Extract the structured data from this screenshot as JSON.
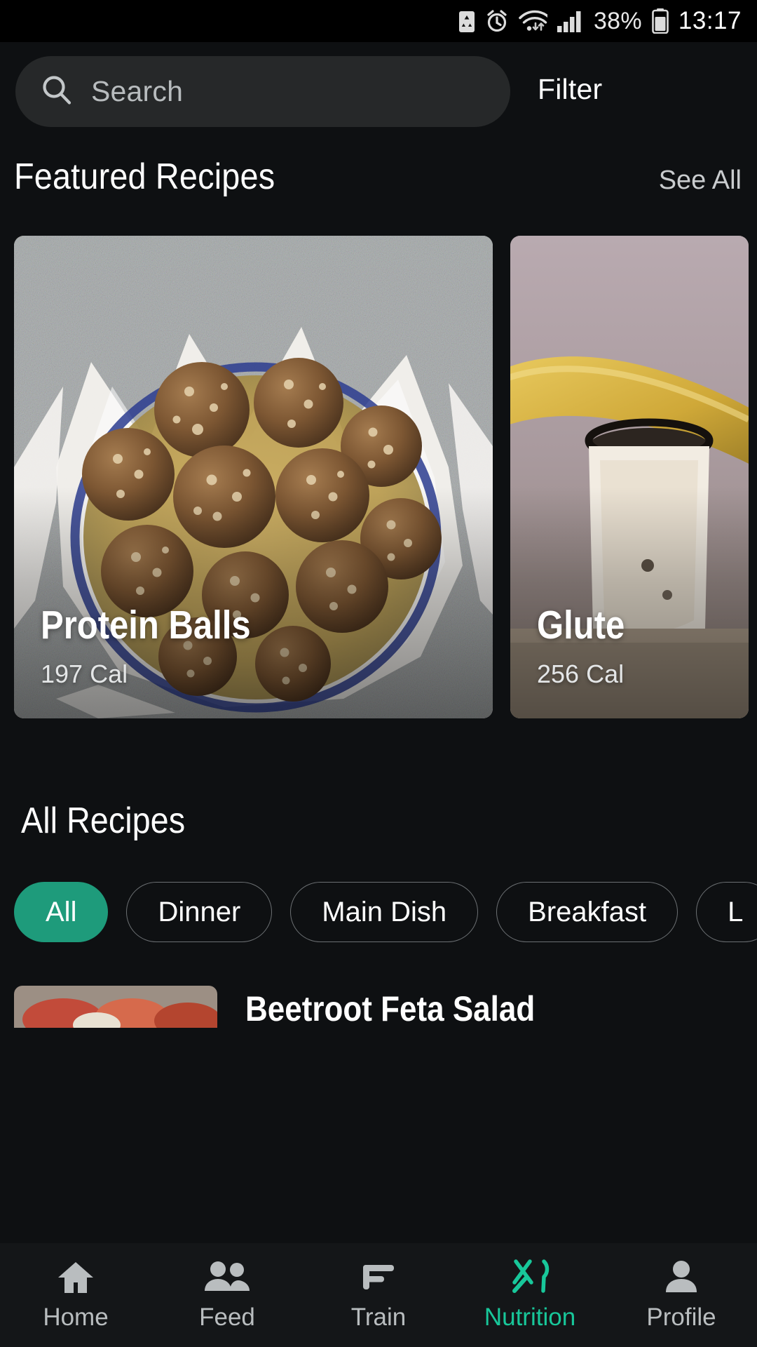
{
  "status_bar": {
    "icons": [
      "battery-saver-icon",
      "alarm-icon",
      "wifi-icon",
      "signal-icon"
    ],
    "battery_percent": "38%",
    "battery_icon": "battery-icon",
    "time": "13:17"
  },
  "search": {
    "icon": "search-icon",
    "placeholder": "Search",
    "value": "",
    "filter_label": "Filter"
  },
  "featured": {
    "title": "Featured Recipes",
    "see_all_label": "See All",
    "cards": [
      {
        "title": "Protein Balls",
        "calories": "197 Cal"
      },
      {
        "title": "Glute",
        "calories": "256 Cal"
      }
    ]
  },
  "all_recipes": {
    "title": "All Recipes",
    "chips": [
      {
        "label": "All",
        "active": true
      },
      {
        "label": "Dinner",
        "active": false
      },
      {
        "label": "Main Dish",
        "active": false
      },
      {
        "label": "Breakfast",
        "active": false
      },
      {
        "label": "L",
        "active": false
      }
    ],
    "peek_row_title": "Beetroot Feta Salad"
  },
  "bottom_nav": {
    "items": [
      {
        "label": "Home",
        "icon": "home-icon",
        "active": false
      },
      {
        "label": "Feed",
        "icon": "people-icon",
        "active": false
      },
      {
        "label": "Train",
        "icon": "dumbbell-icon",
        "active": false
      },
      {
        "label": "Nutrition",
        "icon": "cutlery-icon",
        "active": true
      },
      {
        "label": "Profile",
        "icon": "person-icon",
        "active": false
      }
    ]
  },
  "colors": {
    "background": "#0E1012",
    "surface": "#262829",
    "accent": "#1E9B7B",
    "accent_bright": "#18C79A",
    "text_primary": "#FFFFFF",
    "text_secondary": "#B9BDBF"
  }
}
